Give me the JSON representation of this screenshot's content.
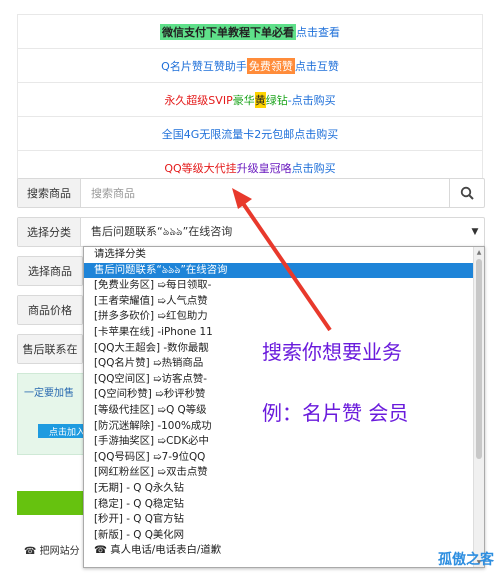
{
  "notices": [
    {
      "parts": [
        {
          "text": "微信支付下单教程下单必看",
          "style": "hl-green"
        },
        {
          "text": " 点击查看",
          "style": "blue"
        }
      ]
    },
    {
      "parts": [
        {
          "text": "Q名片赞互赞助手",
          "style": "blue"
        },
        {
          "text": "免费领赞",
          "style": "hl-orange"
        },
        {
          "text": " 点击互赞",
          "style": "blue"
        }
      ]
    },
    {
      "parts": [
        {
          "text": "永久超级SVIP ",
          "style": "red"
        },
        {
          "text": "豪华",
          "style": "green"
        },
        {
          "text": "黄",
          "style": "yellow-bg"
        },
        {
          "text": "绿钻",
          "style": "green"
        },
        {
          "text": "-点击购买",
          "style": "blue"
        }
      ]
    },
    {
      "parts": [
        {
          "text": "全国4G无限流量卡2元包邮",
          "style": "blue"
        },
        {
          "text": " 点击购买",
          "style": "blue"
        }
      ]
    },
    {
      "parts": [
        {
          "text": "QQ等级大代挂",
          "style": "red"
        },
        {
          "text": " 升级皇冠咯",
          "style": "purple"
        },
        {
          "text": " 点击购买",
          "style": "blue"
        }
      ]
    }
  ],
  "search": {
    "label": "搜索商品",
    "placeholder": "搜索商品",
    "icon": "search-icon"
  },
  "category": {
    "label": "选择分类",
    "selected": "售后问题联系“ঌঌঌ”在线咨询",
    "caret": "▼"
  },
  "goods_label": "选择商品",
  "price_label": "商品价格",
  "after_sales_label": "售后联系在",
  "alert": {
    "text": "一定要加售",
    "button": "点击加入"
  },
  "footer_left": "☎ 把网站分",
  "dropdown": {
    "items": [
      "请选择分类",
      "售后问题联系“ঌঌঌ”在线咨询",
      "[免费业务区] ➯每日领取-",
      "[王者荣耀值] ➯人气点赞",
      "[拼多多砍价] ➯红包助力",
      "[卡苹果在线] -iPhone 11",
      "[QQ大王超会] -数你最靓",
      "[QQ名片赞] ➯热销商品",
      "[QQ空间区] ➯访客点赞-",
      "[Q空间秒赞] ➯秒评秒赞",
      "[等级代挂区] ➯Q Q等级",
      "[防沉迷解除] -100%成功",
      "[手游抽奖区] ➯CDK必中",
      "[QQ号码区] ➯7-9位QQ",
      "[网红粉丝区] ➯双击点赞",
      "[无期] - Q Q永久钻",
      "[稳定] - Q Q稳定钻",
      "[秒开] - Q Q官方钻",
      "[新版] - Q Q美化网",
      "☎ 真人电话/电话表白/道歉"
    ],
    "selected_index": 1
  },
  "annotations": {
    "line1": "搜索你想要业务",
    "line2": "例：名片赞  会员"
  },
  "watermark": "孤傲之客",
  "colors": {
    "accent": "#1e84d8",
    "annotation": "#6a1bdc",
    "arrow": "#e8392c"
  }
}
